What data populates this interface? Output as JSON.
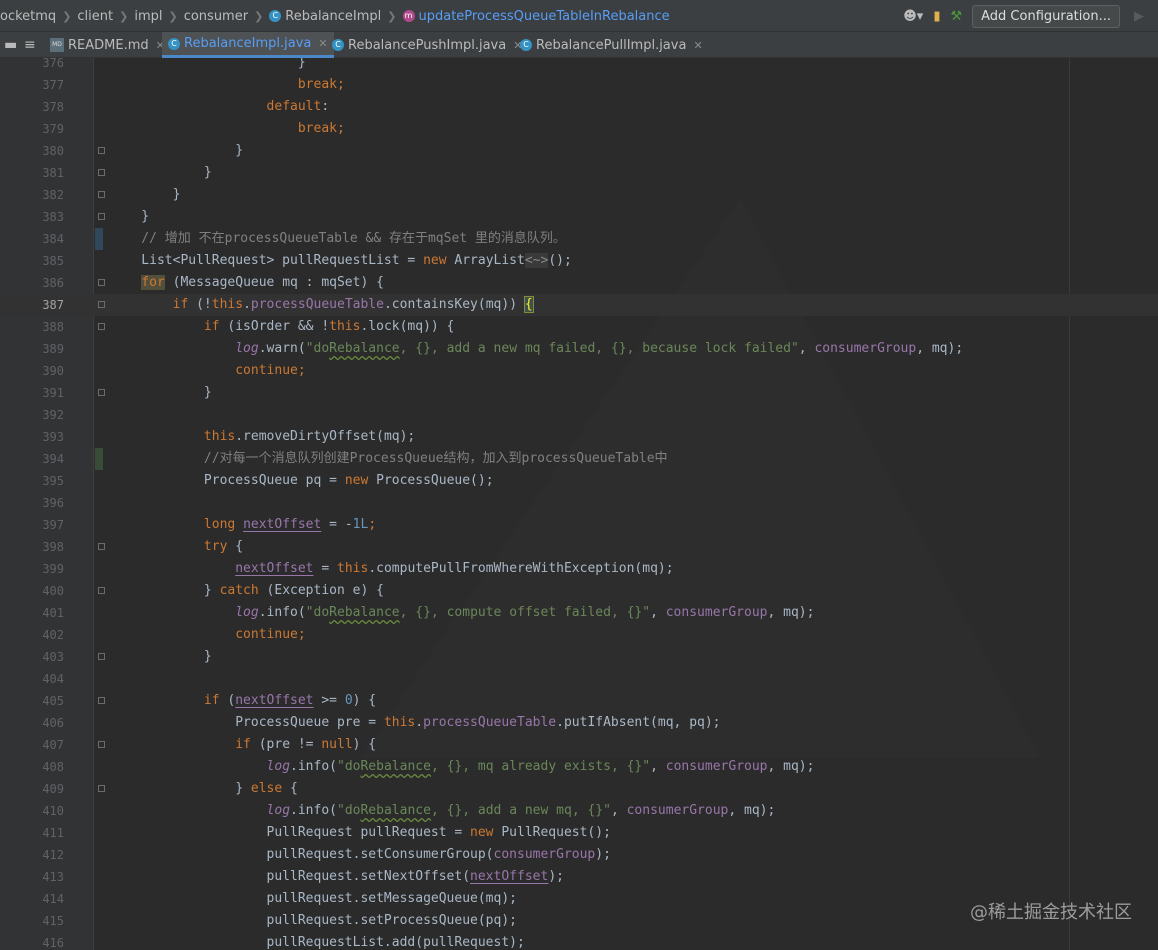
{
  "breadcrumbs": [
    {
      "label": "ocketmq",
      "icon": ""
    },
    {
      "label": "client",
      "icon": ""
    },
    {
      "label": "impl",
      "icon": ""
    },
    {
      "label": "consumer",
      "icon": ""
    },
    {
      "label": "RebalanceImpl",
      "icon": "class-icon"
    },
    {
      "label": "updateProcessQueueTableInRebalance",
      "icon": "method-icon",
      "active": true
    }
  ],
  "toolbar": {
    "add_config_label": "Add Configuration..."
  },
  "tabs": [
    {
      "label": "README.md",
      "icon": "markdown-icon",
      "active": false
    },
    {
      "label": "RebalanceImpl.java",
      "icon": "class-icon",
      "active": true
    },
    {
      "label": "RebalancePushImpl.java",
      "icon": "class-icon",
      "active": false
    },
    {
      "label": "RebalancePullImpl.java",
      "icon": "class-icon",
      "active": false
    }
  ],
  "current_line": 387,
  "lines": [
    {
      "n": 376,
      "fold": false,
      "t": [
        [
          "                        }"
        ]
      ]
    },
    {
      "n": 377,
      "fold": false,
      "t": [
        [
          "                        "
        ],
        [
          "break",
          "kw"
        ],
        [
          ";",
          "kw"
        ]
      ]
    },
    {
      "n": 378,
      "fold": false,
      "t": [
        [
          "                    "
        ],
        [
          "default",
          "kw"
        ],
        [
          ":"
        ]
      ]
    },
    {
      "n": 379,
      "fold": false,
      "t": [
        [
          "                        "
        ],
        [
          "break",
          "kw"
        ],
        [
          ";",
          "kw"
        ]
      ]
    },
    {
      "n": 380,
      "fold": true,
      "t": [
        [
          "                }"
        ]
      ]
    },
    {
      "n": 381,
      "fold": true,
      "t": [
        [
          "            }"
        ]
      ]
    },
    {
      "n": 382,
      "fold": true,
      "t": [
        [
          "        }"
        ]
      ]
    },
    {
      "n": 383,
      "fold": true,
      "t": [
        [
          "    }"
        ]
      ]
    },
    {
      "n": 384,
      "mark": "blue",
      "t": [
        [
          "    // 增加 不在processQueueTable && 存在于mqSet 里的消息队列。",
          "cmt"
        ]
      ]
    },
    {
      "n": 385,
      "t": [
        [
          "    List<PullRequest> pullRequestList = "
        ],
        [
          "new",
          "kw"
        ],
        [
          " ArrayList"
        ],
        [
          "<~>",
          "diam"
        ],
        [
          "();"
        ]
      ]
    },
    {
      "n": 386,
      "fold": true,
      "t": [
        [
          "    "
        ],
        [
          "for",
          "for"
        ],
        [
          " (MessageQueue mq : mqSet) {"
        ]
      ]
    },
    {
      "n": 387,
      "fold": true,
      "t": [
        [
          "        "
        ],
        [
          "if",
          "kw"
        ],
        [
          " (!"
        ],
        [
          "this",
          "kw"
        ],
        [
          "."
        ],
        [
          "processQueueTable",
          "fld"
        ],
        [
          ".containsKey(mq)) "
        ],
        [
          "{",
          "brace"
        ]
      ]
    },
    {
      "n": 388,
      "fold": true,
      "t": [
        [
          "            "
        ],
        [
          "if",
          "kw"
        ],
        [
          " (isOrder && !"
        ],
        [
          "this",
          "kw"
        ],
        [
          ".lock(mq)) {"
        ]
      ]
    },
    {
      "n": 389,
      "t": [
        [
          "                "
        ],
        [
          "log",
          "ital"
        ],
        [
          ".warn("
        ],
        [
          "\"do",
          "str"
        ],
        [
          "Rebalance",
          "strwarn"
        ],
        [
          ", {}, add a new mq failed, {}, because lock failed\"",
          "str"
        ],
        [
          ", "
        ],
        [
          "consumerGroup",
          "fld"
        ],
        [
          ", mq);"
        ]
      ]
    },
    {
      "n": 390,
      "t": [
        [
          "                "
        ],
        [
          "continue",
          "kw"
        ],
        [
          ";",
          "kw"
        ]
      ]
    },
    {
      "n": 391,
      "fold": true,
      "t": [
        [
          "            }"
        ]
      ]
    },
    {
      "n": 392,
      "t": [
        [
          ""
        ]
      ]
    },
    {
      "n": 393,
      "t": [
        [
          "            "
        ],
        [
          "this",
          "kw"
        ],
        [
          ".removeDirtyOffset(mq);"
        ]
      ]
    },
    {
      "n": 394,
      "mark": "green",
      "t": [
        [
          "            //对每一个消息队列创建ProcessQueue结构，加入到processQueueTable中",
          "cmt"
        ]
      ]
    },
    {
      "n": 395,
      "t": [
        [
          "            ProcessQueue pq = "
        ],
        [
          "new",
          "kw"
        ],
        [
          " ProcessQueue();"
        ]
      ]
    },
    {
      "n": 396,
      "t": [
        [
          ""
        ]
      ]
    },
    {
      "n": 397,
      "t": [
        [
          "            "
        ],
        [
          "long",
          "kw"
        ],
        [
          " "
        ],
        [
          "nextOffset",
          "ul"
        ],
        [
          " = -"
        ],
        [
          "1L",
          "num"
        ],
        [
          ";",
          "kw"
        ]
      ]
    },
    {
      "n": 398,
      "fold": true,
      "t": [
        [
          "            "
        ],
        [
          "try",
          "kw"
        ],
        [
          " {"
        ]
      ]
    },
    {
      "n": 399,
      "t": [
        [
          "                "
        ],
        [
          "nextOffset",
          "ul"
        ],
        [
          " = "
        ],
        [
          "this",
          "kw"
        ],
        [
          ".computePullFromWhereWithException(mq);"
        ]
      ]
    },
    {
      "n": 400,
      "fold": true,
      "t": [
        [
          "            } "
        ],
        [
          "catch",
          "kw"
        ],
        [
          " (Exception e) {"
        ]
      ]
    },
    {
      "n": 401,
      "t": [
        [
          "                "
        ],
        [
          "log",
          "ital"
        ],
        [
          ".info("
        ],
        [
          "\"do",
          "str"
        ],
        [
          "Rebalance",
          "strwarn"
        ],
        [
          ", {}, compute offset failed, {}\"",
          "str"
        ],
        [
          ", "
        ],
        [
          "consumerGroup",
          "fld"
        ],
        [
          ", mq);"
        ]
      ]
    },
    {
      "n": 402,
      "t": [
        [
          "                "
        ],
        [
          "continue",
          "kw"
        ],
        [
          ";",
          "kw"
        ]
      ]
    },
    {
      "n": 403,
      "fold": true,
      "t": [
        [
          "            }"
        ]
      ]
    },
    {
      "n": 404,
      "t": [
        [
          ""
        ]
      ]
    },
    {
      "n": 405,
      "fold": true,
      "t": [
        [
          "            "
        ],
        [
          "if",
          "kw"
        ],
        [
          " ("
        ],
        [
          "nextOffset",
          "ul"
        ],
        [
          " >= "
        ],
        [
          "0",
          "num"
        ],
        [
          ") {"
        ]
      ]
    },
    {
      "n": 406,
      "t": [
        [
          "                ProcessQueue pre = "
        ],
        [
          "this",
          "kw"
        ],
        [
          "."
        ],
        [
          "processQueueTable",
          "fld"
        ],
        [
          ".putIfAbsent(mq, pq);"
        ]
      ]
    },
    {
      "n": 407,
      "fold": true,
      "t": [
        [
          "                "
        ],
        [
          "if",
          "kw"
        ],
        [
          " (pre != "
        ],
        [
          "null",
          "kw"
        ],
        [
          ") {"
        ]
      ]
    },
    {
      "n": 408,
      "t": [
        [
          "                    "
        ],
        [
          "log",
          "ital"
        ],
        [
          ".info("
        ],
        [
          "\"do",
          "str"
        ],
        [
          "Rebalance",
          "strwarn"
        ],
        [
          ", {}, mq already exists, {}\"",
          "str"
        ],
        [
          ", "
        ],
        [
          "consumerGroup",
          "fld"
        ],
        [
          ", mq);"
        ]
      ]
    },
    {
      "n": 409,
      "fold": true,
      "t": [
        [
          "                } "
        ],
        [
          "else",
          "kw"
        ],
        [
          " {"
        ]
      ]
    },
    {
      "n": 410,
      "t": [
        [
          "                    "
        ],
        [
          "log",
          "ital"
        ],
        [
          ".info("
        ],
        [
          "\"do",
          "str"
        ],
        [
          "Rebalance",
          "strwarn"
        ],
        [
          ", {}, add a new mq, {}\"",
          "str"
        ],
        [
          ", "
        ],
        [
          "consumerGroup",
          "fld"
        ],
        [
          ", mq);"
        ]
      ]
    },
    {
      "n": 411,
      "t": [
        [
          "                    PullRequest pullRequest = "
        ],
        [
          "new",
          "kw"
        ],
        [
          " PullRequest();"
        ]
      ]
    },
    {
      "n": 412,
      "t": [
        [
          "                    pullRequest.setConsumerGroup("
        ],
        [
          "consumerGroup",
          "fld"
        ],
        [
          ");"
        ]
      ]
    },
    {
      "n": 413,
      "t": [
        [
          "                    pullRequest.setNextOffset("
        ],
        [
          "nextOffset",
          "ul"
        ],
        [
          ");"
        ]
      ]
    },
    {
      "n": 414,
      "t": [
        [
          "                    pullRequest.setMessageQueue(mq);"
        ]
      ]
    },
    {
      "n": 415,
      "t": [
        [
          "                    pullRequest.setProcessQueue(pq);"
        ]
      ]
    },
    {
      "n": 416,
      "t": [
        [
          "                    pullRequestList.add(pullRequest);"
        ]
      ]
    }
  ],
  "watermark": "@稀土掘金技术社区"
}
